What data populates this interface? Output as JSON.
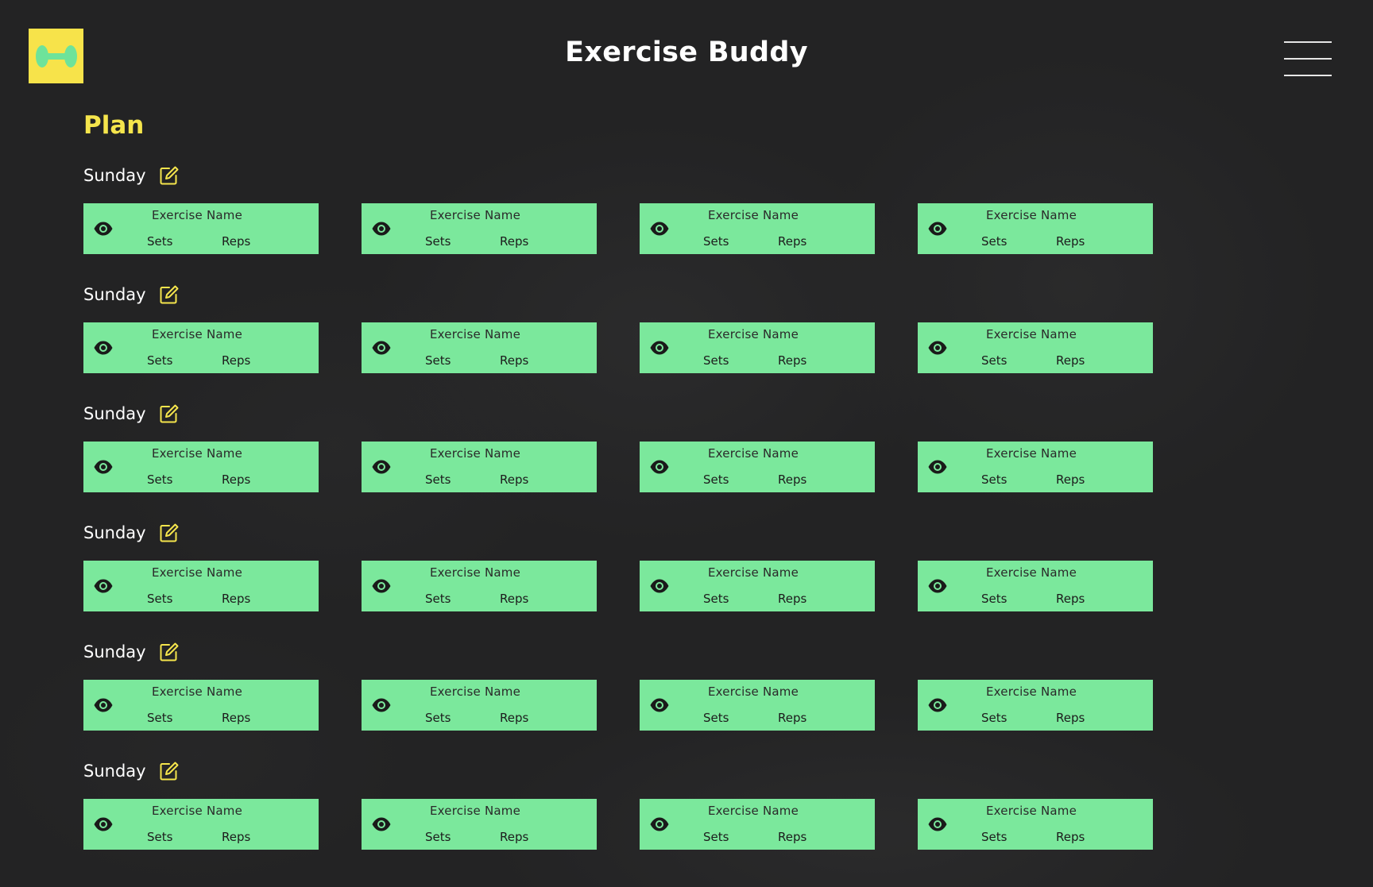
{
  "header": {
    "title": "Exercise Buddy",
    "logo_icon": "dumbbell-icon",
    "menu_icon": "hamburger-menu-icon"
  },
  "colors": {
    "background": "#232324",
    "accent_yellow": "#f5e54c",
    "logo_bg": "#f7e34a",
    "card_green": "#7be89c",
    "icon_dumbbell": "#6ee39a"
  },
  "plan": {
    "title": "Plan",
    "edit_icon": "edit-icon",
    "view_icon": "eye-icon",
    "days": [
      {
        "name": "Sunday",
        "exercises": [
          {
            "name": "Exercise Name",
            "sets": "Sets",
            "reps": "Reps"
          },
          {
            "name": "Exercise Name",
            "sets": "Sets",
            "reps": "Reps"
          },
          {
            "name": "Exercise Name",
            "sets": "Sets",
            "reps": "Reps"
          },
          {
            "name": "Exercise Name",
            "sets": "Sets",
            "reps": "Reps"
          }
        ]
      },
      {
        "name": "Sunday",
        "exercises": [
          {
            "name": "Exercise Name",
            "sets": "Sets",
            "reps": "Reps"
          },
          {
            "name": "Exercise Name",
            "sets": "Sets",
            "reps": "Reps"
          },
          {
            "name": "Exercise Name",
            "sets": "Sets",
            "reps": "Reps"
          },
          {
            "name": "Exercise Name",
            "sets": "Sets",
            "reps": "Reps"
          }
        ]
      },
      {
        "name": "Sunday",
        "exercises": [
          {
            "name": "Exercise Name",
            "sets": "Sets",
            "reps": "Reps"
          },
          {
            "name": "Exercise Name",
            "sets": "Sets",
            "reps": "Reps"
          },
          {
            "name": "Exercise Name",
            "sets": "Sets",
            "reps": "Reps"
          },
          {
            "name": "Exercise Name",
            "sets": "Sets",
            "reps": "Reps"
          }
        ]
      },
      {
        "name": "Sunday",
        "exercises": [
          {
            "name": "Exercise Name",
            "sets": "Sets",
            "reps": "Reps"
          },
          {
            "name": "Exercise Name",
            "sets": "Sets",
            "reps": "Reps"
          },
          {
            "name": "Exercise Name",
            "sets": "Sets",
            "reps": "Reps"
          },
          {
            "name": "Exercise Name",
            "sets": "Sets",
            "reps": "Reps"
          }
        ]
      },
      {
        "name": "Sunday",
        "exercises": [
          {
            "name": "Exercise Name",
            "sets": "Sets",
            "reps": "Reps"
          },
          {
            "name": "Exercise Name",
            "sets": "Sets",
            "reps": "Reps"
          },
          {
            "name": "Exercise Name",
            "sets": "Sets",
            "reps": "Reps"
          },
          {
            "name": "Exercise Name",
            "sets": "Sets",
            "reps": "Reps"
          }
        ]
      },
      {
        "name": "Sunday",
        "exercises": [
          {
            "name": "Exercise Name",
            "sets": "Sets",
            "reps": "Reps"
          },
          {
            "name": "Exercise Name",
            "sets": "Sets",
            "reps": "Reps"
          },
          {
            "name": "Exercise Name",
            "sets": "Sets",
            "reps": "Reps"
          },
          {
            "name": "Exercise Name",
            "sets": "Sets",
            "reps": "Reps"
          }
        ]
      }
    ]
  }
}
